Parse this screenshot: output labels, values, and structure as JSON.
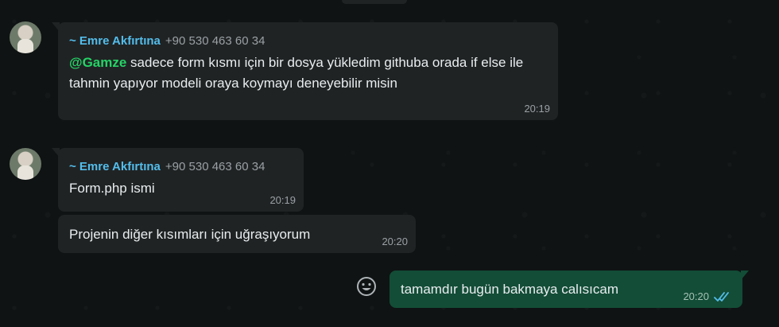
{
  "messages": [
    {
      "sender_name": "~ Emre Akfırtına",
      "sender_phone": "+90 530 463 60 34",
      "mention": "@Gamze",
      "text": " sadece form kısmı için bir dosya yükledim githuba orada if else ile tahmin yapıyor modeli oraya koymayı deneyebilir misin",
      "time": "20:19"
    },
    {
      "sender_name": "~ Emre Akfırtına",
      "sender_phone": "+90 530 463 60 34",
      "text": "Form.php ismi",
      "time": "20:19"
    },
    {
      "text": "Projenin diğer kısımları için uğraşıyorum",
      "time": "20:20"
    },
    {
      "text": "tamamdır bugün bakmaya calısıcam",
      "time": "20:20",
      "status": "read"
    }
  ],
  "icons": {
    "emoji": "smiley-icon",
    "read_receipt": "double-check-icon"
  },
  "colors": {
    "incoming_bubble": "#202324",
    "outgoing_bubble": "#134d37",
    "sender_name": "#53bdeb",
    "mention": "#25d366",
    "read_ticks": "#53bdeb"
  }
}
